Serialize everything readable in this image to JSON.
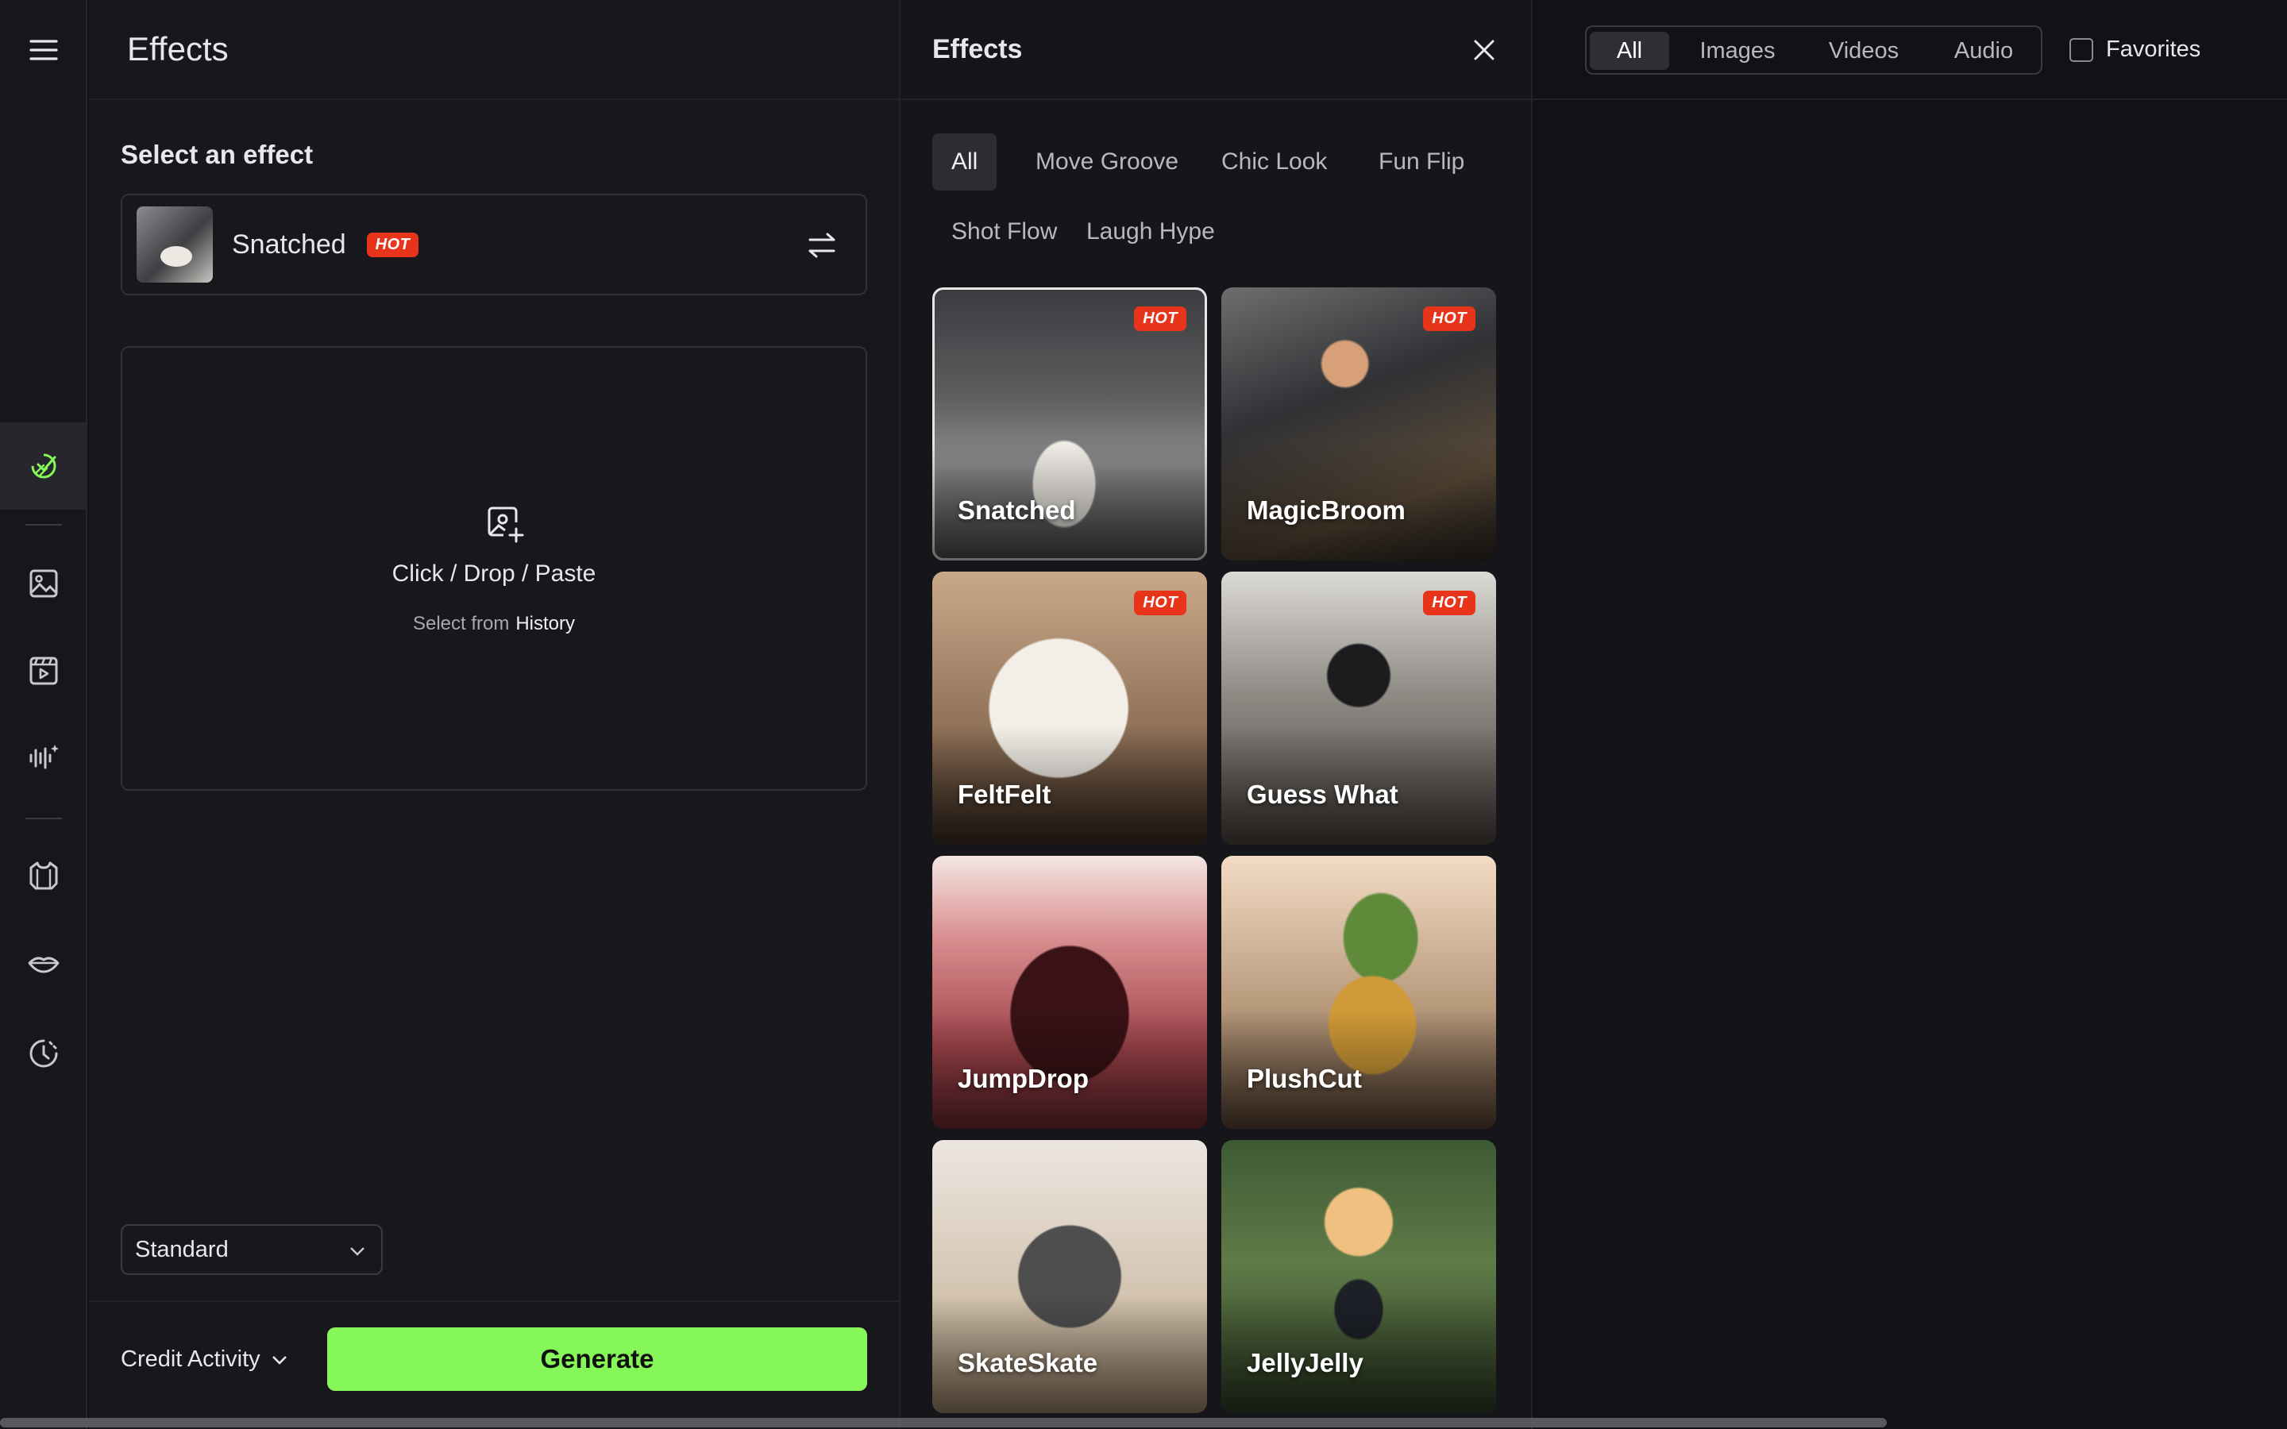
{
  "left_panel": {
    "title": "Effects",
    "section_title": "Select an effect",
    "selected_effect": {
      "name": "Snatched",
      "badge": "HOT"
    },
    "upload": {
      "primary": "Click / Drop / Paste",
      "secondary_prefix": "Select from",
      "secondary_link": "History"
    },
    "quality_select": "Standard",
    "credit_label": "Credit Activity",
    "generate_label": "Generate"
  },
  "effects_panel": {
    "title": "Effects",
    "categories": [
      "All",
      "Move Groove",
      "Chic Look",
      "Fun Flip",
      "Shot Flow",
      "Laugh Hype"
    ],
    "active_category": "All",
    "cards": [
      {
        "label": "Snatched",
        "badge": "HOT",
        "selected": true
      },
      {
        "label": "MagicBroom",
        "badge": "HOT"
      },
      {
        "label": "FeltFelt",
        "badge": "HOT"
      },
      {
        "label": "Guess What",
        "badge": "HOT"
      },
      {
        "label": "JumpDrop",
        "badge": ""
      },
      {
        "label": "PlushCut",
        "badge": ""
      },
      {
        "label": "SkateSkate",
        "badge": ""
      },
      {
        "label": "JellyJelly",
        "badge": ""
      }
    ]
  },
  "right_area": {
    "filters": [
      "All",
      "Images",
      "Videos",
      "Audio"
    ],
    "active_filter": "All",
    "favorites_label": "Favorites"
  },
  "sidebar": {
    "icons": [
      "menu-icon",
      "effects-icon",
      "image-icon",
      "video-icon",
      "audio-icon",
      "outfit-icon",
      "lip-sync-icon",
      "history-icon"
    ],
    "active": "effects-icon"
  },
  "colors": {
    "accent": "#86f758",
    "hot": "#e8341a"
  }
}
